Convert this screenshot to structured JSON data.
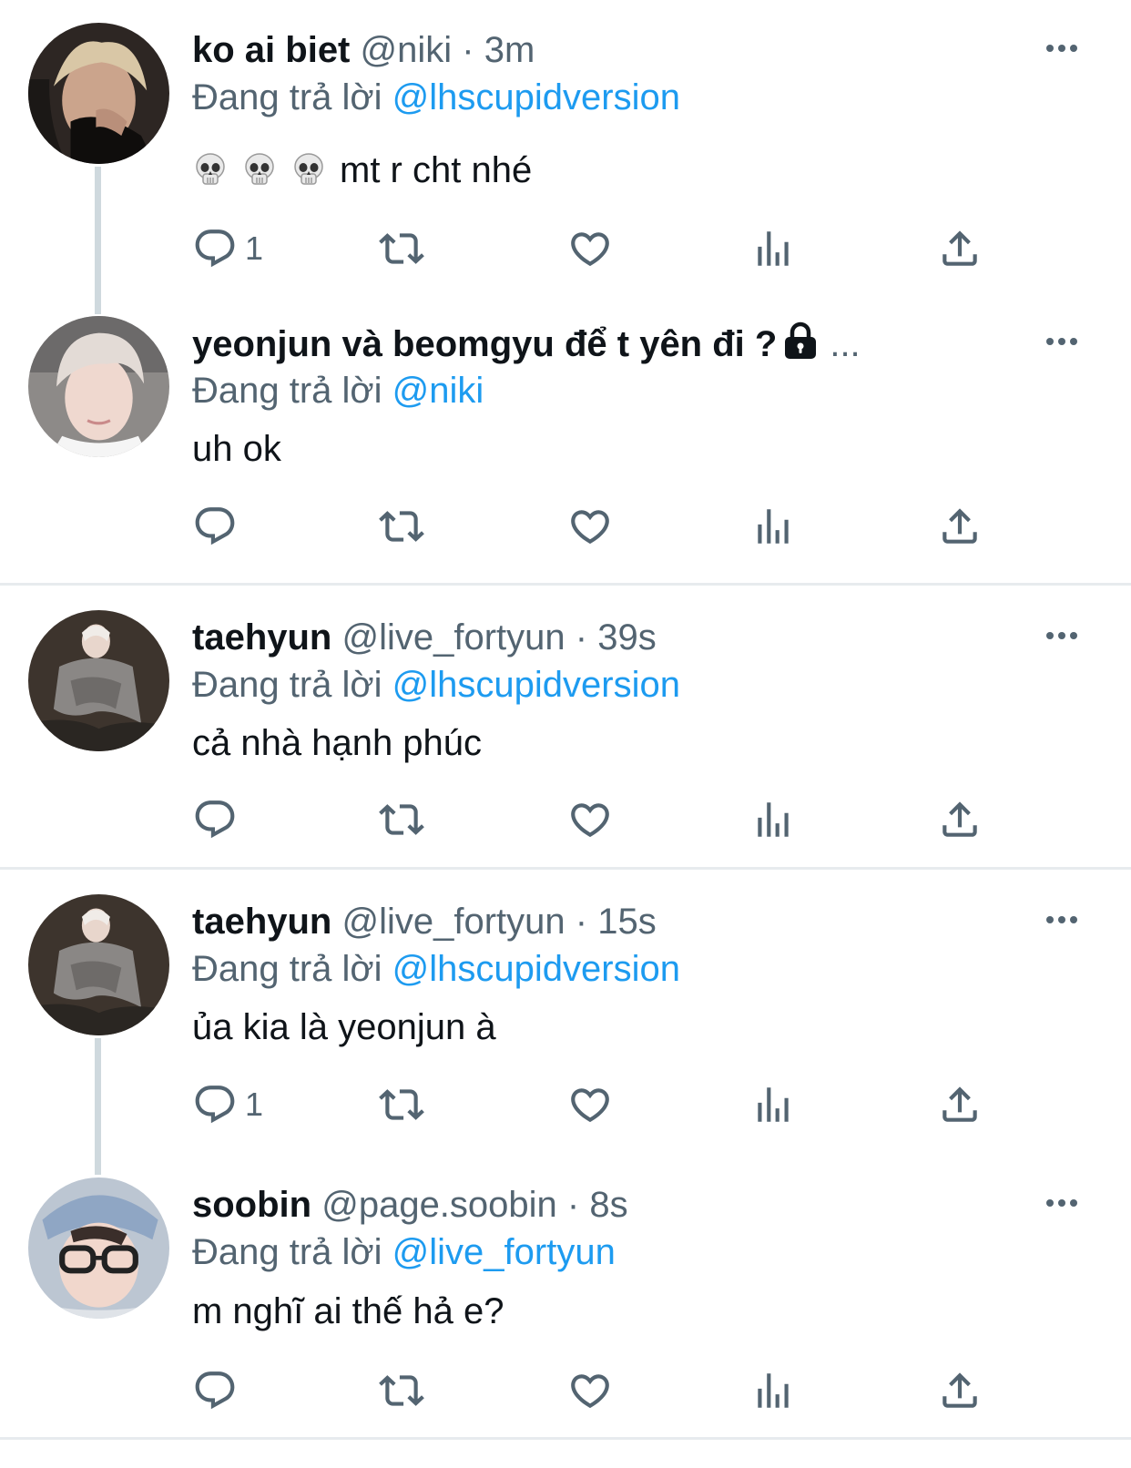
{
  "tweets": [
    {
      "name": "ko ai biet",
      "handle": "@niki",
      "time": "3m",
      "reply_prefix": "Đang trả lời",
      "reply_to": "@lhscupidversion",
      "text": "mt r cht nhé",
      "reply_count": "1",
      "avatar_icon": "avatar-photo"
    },
    {
      "name": "yeonjun và beomgyu để t yên đi ?",
      "name_suffix": "...",
      "reply_prefix": "Đang trả lời",
      "reply_to": "@niki",
      "text": "uh ok",
      "reply_count": "",
      "avatar_icon": "avatar-photo"
    },
    {
      "name": "taehyun",
      "handle": "@live_fortyun",
      "time": "39s",
      "reply_prefix": "Đang trả lời",
      "reply_to": "@lhscupidversion",
      "text": "cả nhà hạnh phúc",
      "reply_count": "",
      "avatar_icon": "avatar-photo"
    },
    {
      "name": "taehyun",
      "handle": "@live_fortyun",
      "time": "15s",
      "reply_prefix": "Đang trả lời",
      "reply_to": "@lhscupidversion",
      "text": "ủa kia là yeonjun à",
      "reply_count": "1",
      "avatar_icon": "avatar-photo"
    },
    {
      "name": "soobin",
      "handle": "@page.soobin",
      "time": "8s",
      "reply_prefix": "Đang trả lời",
      "reply_to": "@live_fortyun",
      "text": "m nghĩ ai thế hả e?",
      "reply_count": "",
      "avatar_icon": "avatar-photo"
    }
  ],
  "separator": "·",
  "icons": {
    "reply": "reply-icon",
    "retweet": "retweet-icon",
    "like": "heart-icon",
    "views": "analytics-icon",
    "share": "share-icon",
    "more": "more-icon",
    "lock": "lock-icon",
    "skull": "skull-emoji"
  },
  "colors": {
    "accent": "#1d9bf0",
    "secondary_text": "#536471",
    "primary_text": "#0f1419",
    "thread_line": "#cfd9de"
  }
}
